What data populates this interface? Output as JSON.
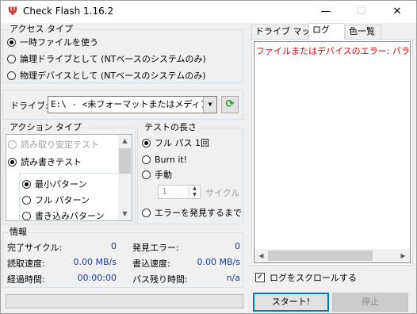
{
  "window": {
    "title": "Check Flash 1.16.2",
    "minimize": "—",
    "maximize": "☐",
    "close": "✕"
  },
  "access_type": {
    "title": "アクセス タイプ",
    "options": [
      {
        "label": "一時ファイルを使う",
        "selected": true
      },
      {
        "label": "論理ドライブとして (NTベースのシステムのみ)",
        "selected": false
      },
      {
        "label": "物理デバイスとして (NTベースのシステムのみ)",
        "selected": false
      }
    ]
  },
  "drive": {
    "label": "ドライブ:",
    "value": "E:\\  -  <未フォーマットまたはメディアなし",
    "refresh_icon": "refresh-icon"
  },
  "action_type": {
    "title": "アクション タイプ",
    "options": [
      {
        "label": "読み取り安定テスト",
        "selected": false,
        "disabled": true
      },
      {
        "label": "読み書きテスト",
        "selected": true,
        "disabled": false
      }
    ],
    "sub_options": [
      {
        "label": "最小パターン",
        "selected": true
      },
      {
        "label": "フル パターン",
        "selected": false
      },
      {
        "label": "書き込みパターン",
        "selected": false
      }
    ]
  },
  "test_length": {
    "title": "テストの長さ",
    "options": [
      {
        "label": "フル パス 1回",
        "selected": true
      },
      {
        "label": "Burn it!",
        "selected": false
      },
      {
        "label": "手動",
        "selected": false
      },
      {
        "label": "エラーを発見するまで",
        "selected": false
      }
    ],
    "cycles_value": "1",
    "cycles_label": "サイクル"
  },
  "info": {
    "title": "情報",
    "rows": [
      {
        "left_label": "完了サイクル:",
        "left_value": "0",
        "right_label": "発見エラー:",
        "right_value": "0"
      },
      {
        "left_label": "読取速度:",
        "left_value": "0.00 MB/s",
        "right_label": "書込速度:",
        "right_value": "0.00 MB/s"
      },
      {
        "left_label": "経過時間:",
        "left_value": "00:00:00",
        "right_label": "パス残り時間:",
        "right_value": "n/a"
      }
    ]
  },
  "tabs": [
    {
      "label": "ドライブ マップ",
      "active": false
    },
    {
      "label": "ログ",
      "active": true
    },
    {
      "label": "色一覧",
      "active": false
    }
  ],
  "log": {
    "lines": [
      "ファイルまたはデバイスのエラー: パラメーター:"
    ]
  },
  "scroll_log": {
    "label": "ログをスクロールする",
    "checked": true
  },
  "buttons": {
    "start": "スタート!",
    "stop": "停止"
  }
}
